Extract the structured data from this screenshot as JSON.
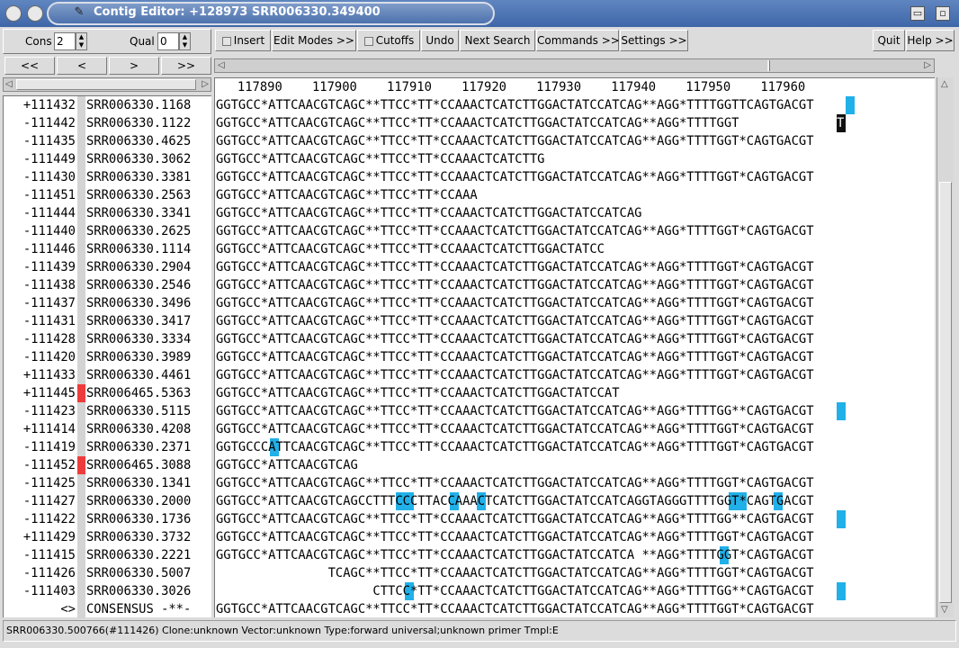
{
  "window": {
    "title": "Contig Editor: +128973 SRR006330.349400",
    "accent": "#4d72ad"
  },
  "toolbar": {
    "cons_label": "Cons",
    "cons_value": "2",
    "qual_label": "Qual",
    "qual_value": "0",
    "insert_label": "Insert",
    "edit_modes_label": "Edit Modes >>",
    "cutoffs_label": "Cutoffs",
    "undo_label": "Undo",
    "next_search_label": "Next Search",
    "commands_label": "Commands >>",
    "settings_label": "Settings >>",
    "quit_label": "Quit",
    "help_label": "Help >>"
  },
  "nav": {
    "first": "<<",
    "prev": "<",
    "next": ">",
    "last": ">>"
  },
  "ruler": "   117890    117900    117910    117920    117930    117940    117950    117960",
  "reads": [
    {
      "num": "+111432",
      "name": "SRR006330.1168",
      "seq": "GGTGCC*ATTCAACGTCAGC**TTCC*TT*CCAAACTCATCTTGGACTATCCATCAG**AGG*TTTTGGTTCAGTGACGT"
    },
    {
      "num": "-111442",
      "name": "SRR006330.1122",
      "seq": "GGTGCC*ATTCAACGTCAGC**TTCC*TT*CCAAACTCATCTTGGACTATCCATCAG**AGG*TTTTGGT"
    },
    {
      "num": "-111435",
      "name": "SRR006330.4625",
      "seq": "GGTGCC*ATTCAACGTCAGC**TTCC*TT*CCAAACTCATCTTGGACTATCCATCAG**AGG*TTTTGGT*CAGTGACGT"
    },
    {
      "num": "-111449",
      "name": "SRR006330.3062",
      "seq": "GGTGCC*ATTCAACGTCAGC**TTCC*TT*CCAAACTCATCTTG"
    },
    {
      "num": "-111430",
      "name": "SRR006330.3381",
      "seq": "GGTGCC*ATTCAACGTCAGC**TTCC*TT*CCAAACTCATCTTGGACTATCCATCAG**AGG*TTTTGGT*CAGTGACGT"
    },
    {
      "num": "-111451",
      "name": "SRR006330.2563",
      "seq": "GGTGCC*ATTCAACGTCAGC**TTCC*TT*CCAAA"
    },
    {
      "num": "-111444",
      "name": "SRR006330.3341",
      "seq": "GGTGCC*ATTCAACGTCAGC**TTCC*TT*CCAAACTCATCTTGGACTATCCATCAG"
    },
    {
      "num": "-111440",
      "name": "SRR006330.2625",
      "seq": "GGTGCC*ATTCAACGTCAGC**TTCC*TT*CCAAACTCATCTTGGACTATCCATCAG**AGG*TTTTGGT*CAGTGACGT"
    },
    {
      "num": "-111446",
      "name": "SRR006330.1114",
      "seq": "GGTGCC*ATTCAACGTCAGC**TTCC*TT*CCAAACTCATCTTGGACTATCC"
    },
    {
      "num": "-111439",
      "name": "SRR006330.2904",
      "seq": "GGTGCC*ATTCAACGTCAGC**TTCC*TT*CCAAACTCATCTTGGACTATCCATCAG**AGG*TTTTGGT*CAGTGACGT"
    },
    {
      "num": "-111438",
      "name": "SRR006330.2546",
      "seq": "GGTGCC*ATTCAACGTCAGC**TTCC*TT*CCAAACTCATCTTGGACTATCCATCAG**AGG*TTTTGGT*CAGTGACGT"
    },
    {
      "num": "-111437",
      "name": "SRR006330.3496",
      "seq": "GGTGCC*ATTCAACGTCAGC**TTCC*TT*CCAAACTCATCTTGGACTATCCATCAG**AGG*TTTTGGT*CAGTGACGT"
    },
    {
      "num": "-111431",
      "name": "SRR006330.3417",
      "seq": "GGTGCC*ATTCAACGTCAGC**TTCC*TT*CCAAACTCATCTTGGACTATCCATCAG**AGG*TTTTGGT*CAGTGACGT"
    },
    {
      "num": "-111428",
      "name": "SRR006330.3334",
      "seq": "GGTGCC*ATTCAACGTCAGC**TTCC*TT*CCAAACTCATCTTGGACTATCCATCAG**AGG*TTTTGGT*CAGTGACGT"
    },
    {
      "num": "-111420",
      "name": "SRR006330.3989",
      "seq": "GGTGCC*ATTCAACGTCAGC**TTCC*TT*CCAAACTCATCTTGGACTATCCATCAG**AGG*TTTTGGT*CAGTGACGT"
    },
    {
      "num": "+111433",
      "name": "SRR006330.4461",
      "seq": "GGTGCC*ATTCAACGTCAGC**TTCC*TT*CCAAACTCATCTTGGACTATCCATCAG**AGG*TTTTGGT*CAGTGACGT"
    },
    {
      "num": "+111445",
      "name": "SRR006465.5363",
      "seq": "GGTGCC*ATTCAACGTCAGC**TTCC*TT*CCAAACTCATCTTGGACTATCCAT",
      "flag": true
    },
    {
      "num": "-111423",
      "name": "SRR006330.5115",
      "seq": "GGTGCC*ATTCAACGTCAGC**TTCC*TT*CCAAACTCATCTTGGACTATCCATCAG**AGG*TTTTGG**CAGTGACGT"
    },
    {
      "num": "+111414",
      "name": "SRR006330.4208",
      "seq": "GGTGCC*ATTCAACGTCAGC**TTCC*TT*CCAAACTCATCTTGGACTATCCATCAG**AGG*TTTTGGT*CAGTGACGT"
    },
    {
      "num": "-111419",
      "name": "SRR006330.2371",
      "seq": "GGTGCCCATTCAACGTCAGC**TTCC*TT*CCAAACTCATCTTGGACTATCCATCAG**AGG*TTTTGGT*CAGTGACGT"
    },
    {
      "num": "-111452",
      "name": "SRR006465.3088",
      "seq": "GGTGCC*ATTCAACGTCAG",
      "flag": true
    },
    {
      "num": "-111425",
      "name": "SRR006330.1341",
      "seq": "GGTGCC*ATTCAACGTCAGC**TTCC*TT*CCAAACTCATCTTGGACTATCCATCAG**AGG*TTTTGGT*CAGTGACGT"
    },
    {
      "num": "-111427",
      "name": "SRR006330.2000",
      "seq": "GGTGCC*ATTCAACGTCAGCCTTTCCCTTACCAAACTCATCTTGGACTATCCATCAGGTAGGGTTTTGGT*CAGTGACGT"
    },
    {
      "num": "-111422",
      "name": "SRR006330.1736",
      "seq": "GGTGCC*ATTCAACGTCAGC**TTCC*TT*CCAAACTCATCTTGGACTATCCATCAG**AGG*TTTTGG**CAGTGACGT"
    },
    {
      "num": "+111429",
      "name": "SRR006330.3732",
      "seq": "GGTGCC*ATTCAACGTCAGC**TTCC*TT*CCAAACTCATCTTGGACTATCCATCAG**AGG*TTTTGGT*CAGTGACGT"
    },
    {
      "num": "-111415",
      "name": "SRR006330.2221",
      "seq": "GGTGCC*ATTCAACGTCAGC**TTCC*TT*CCAAACTCATCTTGGACTATCCATCA **AGG*TTTTGGT*CAGTGACGT"
    },
    {
      "num": "-111426",
      "name": "SRR006330.5007",
      "seq": "               TCAGC**TTCC*TT*CCAAACTCATCTTGGACTATCCATCAG**AGG*TTTTGGT*CAGTGACGT"
    },
    {
      "num": "-111403",
      "name": "SRR006330.3026",
      "seq": "                     CTTCC*TT*CCAAACTCATCTTGGACTATCCATCAG**AGG*TTTTGG**CAGTGACGT"
    }
  ],
  "consensus": {
    "num": "<>",
    "name": "CONSENSUS -**-",
    "seq": "GGTGCC*ATTCAACGTCAGC**TTCC*TT*CCAAACTCATCTTGGACTATCCATCAG**AGG*TTTTGGT*CAGTGACGT"
  },
  "highlight_color": "#21b0e8",
  "flag_color": "#ee3c3c",
  "status_text": "SRR006330.500766(#111426) Clone:unknown Vector:unknown Type:forward universal;unknown primer Tmpl:E"
}
